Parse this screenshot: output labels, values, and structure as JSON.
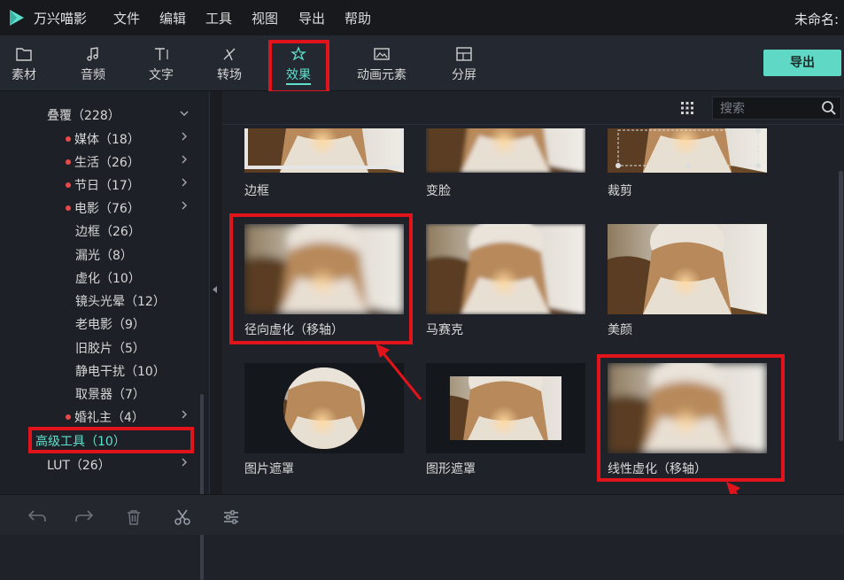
{
  "app": {
    "name": "万兴喵影",
    "document_name": "未命名:"
  },
  "menu": [
    "文件",
    "编辑",
    "工具",
    "视图",
    "导出",
    "帮助"
  ],
  "toolbar": {
    "tabs": [
      {
        "label": "素材",
        "icon": "folder-icon"
      },
      {
        "label": "音频",
        "icon": "music-note-icon"
      },
      {
        "label": "文字",
        "icon": "text-icon"
      },
      {
        "label": "转场",
        "icon": "transition-icon"
      },
      {
        "label": "效果",
        "icon": "effects-icon",
        "active": true
      },
      {
        "label": "动画元素",
        "icon": "image-icon"
      },
      {
        "label": "分屏",
        "icon": "split-screen-icon"
      }
    ],
    "export_label": "导出"
  },
  "sidebar": {
    "items": [
      {
        "label": "叠覆（228）",
        "dot": false,
        "chevron": "down"
      },
      {
        "label": "媒体（18）",
        "dot": true,
        "chevron": "right"
      },
      {
        "label": "生活（26）",
        "dot": true,
        "chevron": "right"
      },
      {
        "label": "节日（17）",
        "dot": true,
        "chevron": "right"
      },
      {
        "label": "电影（76）",
        "dot": true,
        "chevron": "right"
      },
      {
        "label": "边框（26）",
        "dot": false,
        "chevron": ""
      },
      {
        "label": "漏光（8）",
        "dot": false,
        "chevron": ""
      },
      {
        "label": "虚化（10）",
        "dot": false,
        "chevron": ""
      },
      {
        "label": "镜头光晕（12）",
        "dot": false,
        "chevron": ""
      },
      {
        "label": "老电影（9）",
        "dot": false,
        "chevron": ""
      },
      {
        "label": "旧胶片（5）",
        "dot": false,
        "chevron": ""
      },
      {
        "label": "静电干扰（10）",
        "dot": false,
        "chevron": ""
      },
      {
        "label": "取景器（7）",
        "dot": false,
        "chevron": ""
      },
      {
        "label": "婚礼主（4）",
        "dot": true,
        "chevron": "right"
      },
      {
        "label": "高级工具（10）",
        "dot": false,
        "chevron": "",
        "selected": true
      },
      {
        "label": "LUT（26）",
        "dot": false,
        "chevron": "right"
      }
    ]
  },
  "search": {
    "placeholder": "搜索"
  },
  "effects": [
    {
      "label": "边框"
    },
    {
      "label": "变脸"
    },
    {
      "label": "裁剪"
    },
    {
      "label": "径向虚化（移轴）"
    },
    {
      "label": "马赛克"
    },
    {
      "label": "美颜"
    },
    {
      "label": "图片遮罩"
    },
    {
      "label": "图形遮罩"
    },
    {
      "label": "线性虚化（移轴）"
    }
  ],
  "colors": {
    "accent": "#5fe0cd",
    "highlight": "#e1141b",
    "export_button": "#5fd9c5",
    "dot": "#e84a4a"
  },
  "bottombar": {
    "icons": [
      "undo-icon",
      "redo-icon",
      "trash-icon",
      "scissors-icon",
      "adjust-icon"
    ]
  }
}
